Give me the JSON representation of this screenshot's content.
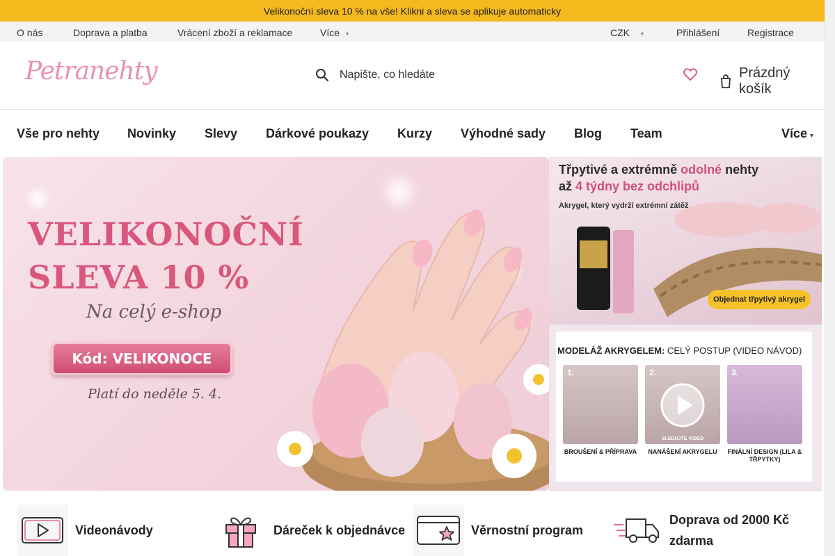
{
  "announcement": {
    "text": "Velikonoční sleva 10 % na vše! Klikni a sleva se aplikuje automaticky",
    "glyph_left": "",
    "glyph_right": "",
    "close_glyph": ""
  },
  "topbar": {
    "links": [
      "O nás",
      "Doprava a platba",
      "Vrácení zboží a reklamace",
      "Více"
    ],
    "currency": "CZK",
    "login": "Přihlášení",
    "register": "Registrace"
  },
  "header": {
    "logo_text": "Petranehty",
    "search_placeholder": "Napište, co hledáte",
    "cart_label": "Prázdný košík"
  },
  "mainnav": {
    "items": [
      "Vše pro nehty",
      "Novinky",
      "Slevy",
      "Dárkové poukazy",
      "Kurzy",
      "Výhodné sady",
      "Blog",
      "Team"
    ],
    "more": "Více"
  },
  "banner_main": {
    "title_line1": "VELIKONOČNÍ",
    "title_line2": "SLEVA 10 %",
    "subtitle": "Na celý e-shop",
    "code": "Kód: VELIKONOCE",
    "valid": "Platí do neděle 5. 4."
  },
  "banner_r1": {
    "title_part1": "Třpytivé a extrémně ",
    "title_pink1": "odolné",
    "title_part2": " nehty",
    "title_line2_a": "až ",
    "title_line2_pink": "4 týdny bez odchlipů",
    "small": "Akrygel, který vydrží extrémní zátěž",
    "button": "Objednat třpytivý akrygel"
  },
  "banner_r2": {
    "title_bold": "MODELÁŽ AKRYGELEM:",
    "title_light": " CELÝ POSTUP (VIDEO NÁVOD)",
    "steps": [
      {
        "num": "1.",
        "caption": "BROUŠENÍ & PŘÍPRAVA"
      },
      {
        "num": "2.",
        "caption": "NANÁŠENÍ AKRYGELU"
      },
      {
        "num": "3.",
        "caption": "FINÁLNÍ DESIGN (LILA & TŘPYTKY)"
      }
    ],
    "video_label": "SLEDUJTE VIDEO"
  },
  "features": [
    {
      "label": "Videonávody",
      "icon": "video-play-icon"
    },
    {
      "label": "Dáreček k objednávce",
      "icon": "gift-icon"
    },
    {
      "label": "Věrnostní program",
      "icon": "loyalty-card-icon"
    },
    {
      "label": "Doprava od 2000 Kč zdarma",
      "icon": "delivery-truck-icon"
    }
  ],
  "colors": {
    "announce_bg": "#f5b91e",
    "accent_pink": "#d24f79",
    "logo_pink": "#e892ab"
  }
}
